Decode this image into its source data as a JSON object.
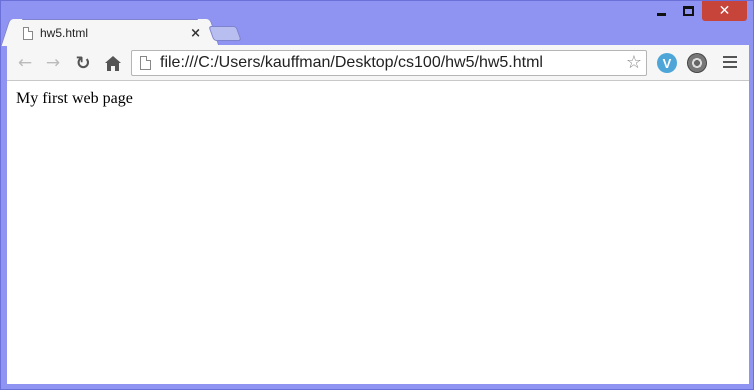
{
  "window": {
    "controls": {
      "minimize": "minimize",
      "maximize": "maximize",
      "close": "close"
    }
  },
  "tabs": [
    {
      "title": "hw5.html",
      "active": true,
      "close_glyph": "×"
    }
  ],
  "toolbar": {
    "back_glyph": "←",
    "forward_glyph": "→",
    "reload_glyph": "↻",
    "address": "file:///C:/Users/kauffman/Desktop/cs100/hw5/hw5.html",
    "star_glyph": "☆",
    "extension_v_label": "V"
  },
  "page": {
    "text": "My first web page"
  },
  "colors": {
    "frame": "#8f93f2",
    "close_button": "#c7443b",
    "toolbar_bg": "#f6f6f6",
    "extension_blue": "#4ea6d8"
  }
}
